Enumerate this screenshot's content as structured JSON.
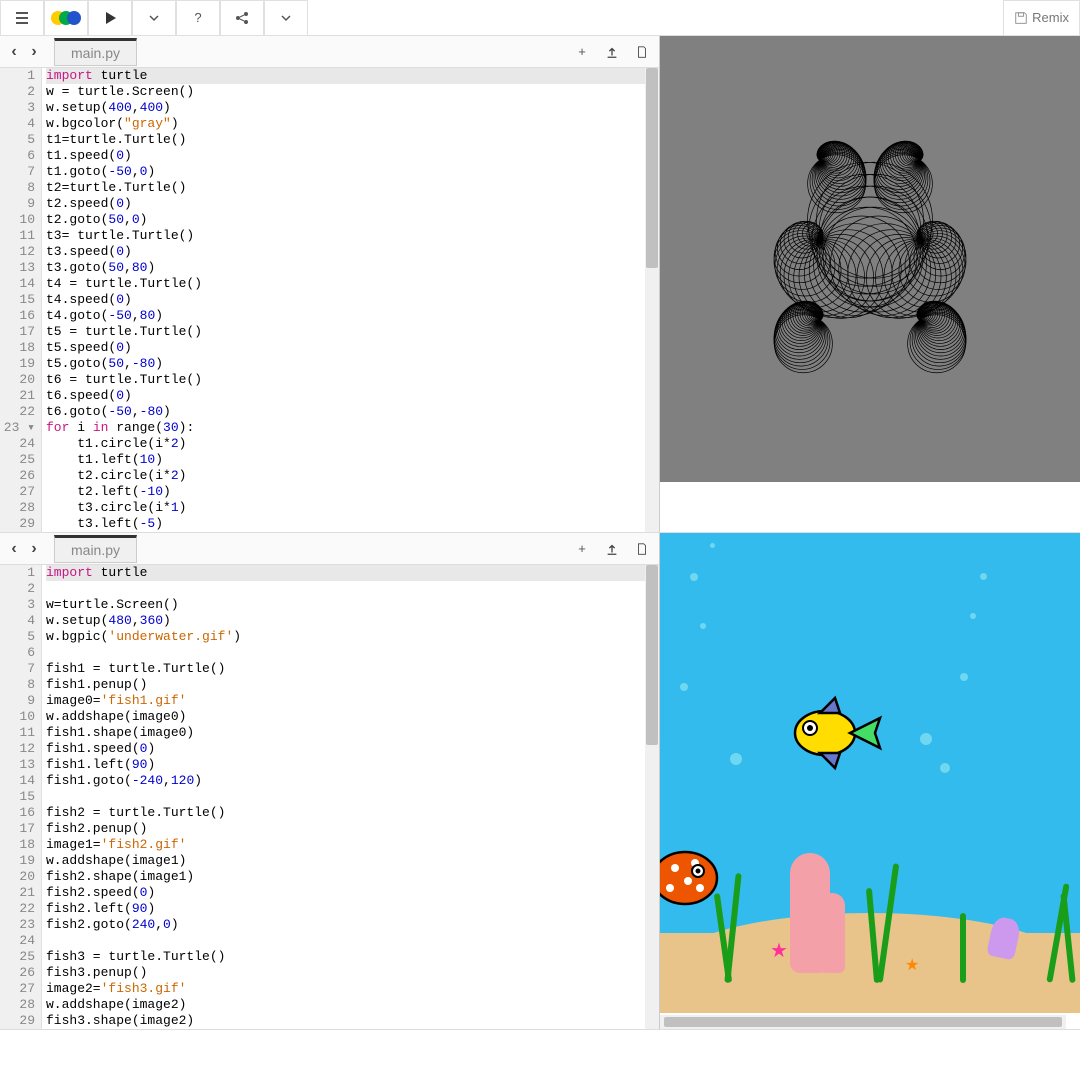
{
  "toolbar": {
    "remix_label": "Remix"
  },
  "instance1": {
    "tab_name": "main.py",
    "code_lines": [
      {
        "n": 1,
        "tokens": [
          {
            "t": "import",
            "c": "kw"
          },
          {
            "t": " turtle",
            "c": "id"
          }
        ]
      },
      {
        "n": 2,
        "tokens": [
          {
            "t": "w = turtle.Screen()",
            "c": "id"
          }
        ]
      },
      {
        "n": 3,
        "tokens": [
          {
            "t": "w.setup(",
            "c": "id"
          },
          {
            "t": "400",
            "c": "num"
          },
          {
            "t": ",",
            "c": "id"
          },
          {
            "t": "400",
            "c": "num"
          },
          {
            "t": ")",
            "c": "id"
          }
        ]
      },
      {
        "n": 4,
        "tokens": [
          {
            "t": "w.bgcolor(",
            "c": "id"
          },
          {
            "t": "\"gray\"",
            "c": "str"
          },
          {
            "t": ")",
            "c": "id"
          }
        ]
      },
      {
        "n": 5,
        "tokens": [
          {
            "t": "t1=turtle.Turtle()",
            "c": "id"
          }
        ]
      },
      {
        "n": 6,
        "tokens": [
          {
            "t": "t1.speed(",
            "c": "id"
          },
          {
            "t": "0",
            "c": "num"
          },
          {
            "t": ")",
            "c": "id"
          }
        ]
      },
      {
        "n": 7,
        "tokens": [
          {
            "t": "t1.goto(",
            "c": "id"
          },
          {
            "t": "-50",
            "c": "num"
          },
          {
            "t": ",",
            "c": "id"
          },
          {
            "t": "0",
            "c": "num"
          },
          {
            "t": ")",
            "c": "id"
          }
        ]
      },
      {
        "n": 8,
        "tokens": [
          {
            "t": "t2=turtle.Turtle()",
            "c": "id"
          }
        ]
      },
      {
        "n": 9,
        "tokens": [
          {
            "t": "t2.speed(",
            "c": "id"
          },
          {
            "t": "0",
            "c": "num"
          },
          {
            "t": ")",
            "c": "id"
          }
        ]
      },
      {
        "n": 10,
        "tokens": [
          {
            "t": "t2.goto(",
            "c": "id"
          },
          {
            "t": "50",
            "c": "num"
          },
          {
            "t": ",",
            "c": "id"
          },
          {
            "t": "0",
            "c": "num"
          },
          {
            "t": ")",
            "c": "id"
          }
        ]
      },
      {
        "n": 11,
        "tokens": [
          {
            "t": "t3= turtle.Turtle()",
            "c": "id"
          }
        ]
      },
      {
        "n": 12,
        "tokens": [
          {
            "t": "t3.speed(",
            "c": "id"
          },
          {
            "t": "0",
            "c": "num"
          },
          {
            "t": ")",
            "c": "id"
          }
        ]
      },
      {
        "n": 13,
        "tokens": [
          {
            "t": "t3.goto(",
            "c": "id"
          },
          {
            "t": "50",
            "c": "num"
          },
          {
            "t": ",",
            "c": "id"
          },
          {
            "t": "80",
            "c": "num"
          },
          {
            "t": ")",
            "c": "id"
          }
        ]
      },
      {
        "n": 14,
        "tokens": [
          {
            "t": "t4 = turtle.Turtle()",
            "c": "id"
          }
        ]
      },
      {
        "n": 15,
        "tokens": [
          {
            "t": "t4.speed(",
            "c": "id"
          },
          {
            "t": "0",
            "c": "num"
          },
          {
            "t": ")",
            "c": "id"
          }
        ]
      },
      {
        "n": 16,
        "tokens": [
          {
            "t": "t4.goto(",
            "c": "id"
          },
          {
            "t": "-50",
            "c": "num"
          },
          {
            "t": ",",
            "c": "id"
          },
          {
            "t": "80",
            "c": "num"
          },
          {
            "t": ")",
            "c": "id"
          }
        ]
      },
      {
        "n": 17,
        "tokens": [
          {
            "t": "t5 = turtle.Turtle()",
            "c": "id"
          }
        ]
      },
      {
        "n": 18,
        "tokens": [
          {
            "t": "t5.speed(",
            "c": "id"
          },
          {
            "t": "0",
            "c": "num"
          },
          {
            "t": ")",
            "c": "id"
          }
        ]
      },
      {
        "n": 19,
        "tokens": [
          {
            "t": "t5.goto(",
            "c": "id"
          },
          {
            "t": "50",
            "c": "num"
          },
          {
            "t": ",",
            "c": "id"
          },
          {
            "t": "-80",
            "c": "num"
          },
          {
            "t": ")",
            "c": "id"
          }
        ]
      },
      {
        "n": 20,
        "tokens": [
          {
            "t": "t6 = turtle.Turtle()",
            "c": "id"
          }
        ]
      },
      {
        "n": 21,
        "tokens": [
          {
            "t": "t6.speed(",
            "c": "id"
          },
          {
            "t": "0",
            "c": "num"
          },
          {
            "t": ")",
            "c": "id"
          }
        ]
      },
      {
        "n": 22,
        "tokens": [
          {
            "t": "t6.goto(",
            "c": "id"
          },
          {
            "t": "-50",
            "c": "num"
          },
          {
            "t": ",",
            "c": "id"
          },
          {
            "t": "-80",
            "c": "num"
          },
          {
            "t": ")",
            "c": "id"
          }
        ]
      },
      {
        "n": 23,
        "tokens": [
          {
            "t": "for",
            "c": "kw"
          },
          {
            "t": " i ",
            "c": "id"
          },
          {
            "t": "in",
            "c": "kw"
          },
          {
            "t": " range(",
            "c": "id"
          },
          {
            "t": "30",
            "c": "num"
          },
          {
            "t": "):",
            "c": "id"
          }
        ],
        "fold": true
      },
      {
        "n": 24,
        "tokens": [
          {
            "t": "    t1.circle(i*",
            "c": "id"
          },
          {
            "t": "2",
            "c": "num"
          },
          {
            "t": ")",
            "c": "id"
          }
        ]
      },
      {
        "n": 25,
        "tokens": [
          {
            "t": "    t1.left(",
            "c": "id"
          },
          {
            "t": "10",
            "c": "num"
          },
          {
            "t": ")",
            "c": "id"
          }
        ]
      },
      {
        "n": 26,
        "tokens": [
          {
            "t": "    t2.circle(i*",
            "c": "id"
          },
          {
            "t": "2",
            "c": "num"
          },
          {
            "t": ")",
            "c": "id"
          }
        ]
      },
      {
        "n": 27,
        "tokens": [
          {
            "t": "    t2.left(",
            "c": "id"
          },
          {
            "t": "-10",
            "c": "num"
          },
          {
            "t": ")",
            "c": "id"
          }
        ]
      },
      {
        "n": 28,
        "tokens": [
          {
            "t": "    t3.circle(i*",
            "c": "id"
          },
          {
            "t": "1",
            "c": "num"
          },
          {
            "t": ")",
            "c": "id"
          }
        ]
      },
      {
        "n": 29,
        "tokens": [
          {
            "t": "    t3.left(",
            "c": "id"
          },
          {
            "t": "-5",
            "c": "num"
          },
          {
            "t": ")",
            "c": "id"
          }
        ]
      }
    ]
  },
  "instance2": {
    "tab_name": "main.py",
    "code_lines": [
      {
        "n": 1,
        "tokens": [
          {
            "t": "import",
            "c": "kw"
          },
          {
            "t": " turtle",
            "c": "id"
          }
        ]
      },
      {
        "n": 2,
        "tokens": []
      },
      {
        "n": 3,
        "tokens": [
          {
            "t": "w=turtle.Screen()",
            "c": "id"
          }
        ]
      },
      {
        "n": 4,
        "tokens": [
          {
            "t": "w.setup(",
            "c": "id"
          },
          {
            "t": "480",
            "c": "num"
          },
          {
            "t": ",",
            "c": "id"
          },
          {
            "t": "360",
            "c": "num"
          },
          {
            "t": ")",
            "c": "id"
          }
        ]
      },
      {
        "n": 5,
        "tokens": [
          {
            "t": "w.bgpic(",
            "c": "id"
          },
          {
            "t": "'underwater.gif'",
            "c": "str"
          },
          {
            "t": ")",
            "c": "id"
          }
        ]
      },
      {
        "n": 6,
        "tokens": []
      },
      {
        "n": 7,
        "tokens": [
          {
            "t": "fish1 = turtle.Turtle()",
            "c": "id"
          }
        ]
      },
      {
        "n": 8,
        "tokens": [
          {
            "t": "fish1.penup()",
            "c": "id"
          }
        ]
      },
      {
        "n": 9,
        "tokens": [
          {
            "t": "image0=",
            "c": "id"
          },
          {
            "t": "'fish1.gif'",
            "c": "str"
          }
        ]
      },
      {
        "n": 10,
        "tokens": [
          {
            "t": "w.addshape(image0)",
            "c": "id"
          }
        ]
      },
      {
        "n": 11,
        "tokens": [
          {
            "t": "fish1.shape(image0)",
            "c": "id"
          }
        ]
      },
      {
        "n": 12,
        "tokens": [
          {
            "t": "fish1.speed(",
            "c": "id"
          },
          {
            "t": "0",
            "c": "num"
          },
          {
            "t": ")",
            "c": "id"
          }
        ]
      },
      {
        "n": 13,
        "tokens": [
          {
            "t": "fish1.left(",
            "c": "id"
          },
          {
            "t": "90",
            "c": "num"
          },
          {
            "t": ")",
            "c": "id"
          }
        ]
      },
      {
        "n": 14,
        "tokens": [
          {
            "t": "fish1.goto(",
            "c": "id"
          },
          {
            "t": "-240",
            "c": "num"
          },
          {
            "t": ",",
            "c": "id"
          },
          {
            "t": "120",
            "c": "num"
          },
          {
            "t": ")",
            "c": "id"
          }
        ]
      },
      {
        "n": 15,
        "tokens": []
      },
      {
        "n": 16,
        "tokens": [
          {
            "t": "fish2 = turtle.Turtle()",
            "c": "id"
          }
        ]
      },
      {
        "n": 17,
        "tokens": [
          {
            "t": "fish2.penup()",
            "c": "id"
          }
        ]
      },
      {
        "n": 18,
        "tokens": [
          {
            "t": "image1=",
            "c": "id"
          },
          {
            "t": "'fish2.gif'",
            "c": "str"
          }
        ]
      },
      {
        "n": 19,
        "tokens": [
          {
            "t": "w.addshape(image1)",
            "c": "id"
          }
        ]
      },
      {
        "n": 20,
        "tokens": [
          {
            "t": "fish2.shape(image1)",
            "c": "id"
          }
        ]
      },
      {
        "n": 21,
        "tokens": [
          {
            "t": "fish2.speed(",
            "c": "id"
          },
          {
            "t": "0",
            "c": "num"
          },
          {
            "t": ")",
            "c": "id"
          }
        ]
      },
      {
        "n": 22,
        "tokens": [
          {
            "t": "fish2.left(",
            "c": "id"
          },
          {
            "t": "90",
            "c": "num"
          },
          {
            "t": ")",
            "c": "id"
          }
        ]
      },
      {
        "n": 23,
        "tokens": [
          {
            "t": "fish2.goto(",
            "c": "id"
          },
          {
            "t": "240",
            "c": "num"
          },
          {
            "t": ",",
            "c": "id"
          },
          {
            "t": "0",
            "c": "num"
          },
          {
            "t": ")",
            "c": "id"
          }
        ]
      },
      {
        "n": 24,
        "tokens": []
      },
      {
        "n": 25,
        "tokens": [
          {
            "t": "fish3 = turtle.Turtle()",
            "c": "id"
          }
        ]
      },
      {
        "n": 26,
        "tokens": [
          {
            "t": "fish3.penup()",
            "c": "id"
          }
        ]
      },
      {
        "n": 27,
        "tokens": [
          {
            "t": "image2=",
            "c": "id"
          },
          {
            "t": "'fish3.gif'",
            "c": "str"
          }
        ]
      },
      {
        "n": 28,
        "tokens": [
          {
            "t": "w.addshape(image2)",
            "c": "id"
          }
        ]
      },
      {
        "n": 29,
        "tokens": [
          {
            "t": "fish3.shape(image2)",
            "c": "id"
          }
        ]
      }
    ]
  }
}
